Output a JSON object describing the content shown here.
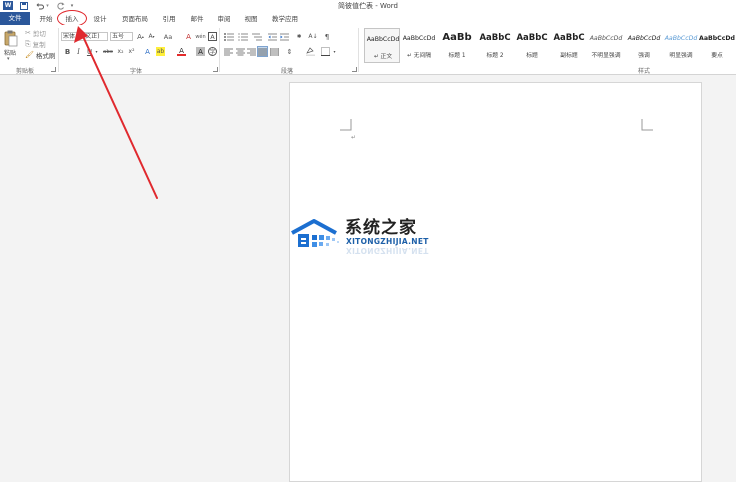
{
  "window": {
    "title": "简彼值伫表 - Word"
  },
  "qat": {
    "logo": "W",
    "save_icon": "save-icon",
    "undo_icon": "undo-icon",
    "redo_icon": "redo-icon",
    "customize_icon": "customize-icon"
  },
  "tabs": [
    {
      "label": "文件"
    },
    {
      "label": "开始"
    },
    {
      "label": "插入"
    },
    {
      "label": "设计"
    },
    {
      "label": "页面布局"
    },
    {
      "label": "引用"
    },
    {
      "label": "邮件"
    },
    {
      "label": "审阅"
    },
    {
      "label": "视图"
    },
    {
      "label": "教学应用"
    }
  ],
  "clipboard": {
    "paste": "粘贴",
    "cut": "剪切",
    "copy": "复制",
    "format_painter": "格式刷",
    "label": "剪贴板"
  },
  "font": {
    "family": "宋体 (中文正) ",
    "size": "五号",
    "grow": "A",
    "shrink": "A",
    "case": "Aa",
    "clear": "A",
    "phonetic": "wén",
    "border": "A",
    "bold": "B",
    "italic": "I",
    "underline": "U",
    "strike": "abc",
    "subscript": "x₂",
    "superscript": "x²",
    "effects": "A",
    "highlight": "ab",
    "color": "A",
    "shading": "A",
    "enclose": "字",
    "label": "字体"
  },
  "paragraph": {
    "label": "段落"
  },
  "styles": {
    "label": "样式",
    "items": [
      {
        "sample": "AaBbCcDd",
        "name": "↵ 正文"
      },
      {
        "sample": "AaBbCcDd",
        "name": "↵ 无间隔"
      },
      {
        "sample": "AaBb",
        "name": "标题 1"
      },
      {
        "sample": "AaBbC",
        "name": "标题 2"
      },
      {
        "sample": "AaBbC",
        "name": "标题"
      },
      {
        "sample": "AaBbC",
        "name": "副标题"
      },
      {
        "sample": "AaBbCcDd",
        "name": "不明显强调"
      },
      {
        "sample": "AaBbCcDd",
        "name": "强调"
      },
      {
        "sample": "AaBbCcDd",
        "name": "明显强调"
      },
      {
        "sample": "AaBbCcDd",
        "name": "要点"
      }
    ]
  },
  "watermark": {
    "cn": "系统之家",
    "en": "XITONGZHIJIA.NET"
  },
  "document": {
    "paragraph_mark": "↵"
  },
  "colors": {
    "brand": "#2b579a",
    "annotation": "#e0292e"
  }
}
